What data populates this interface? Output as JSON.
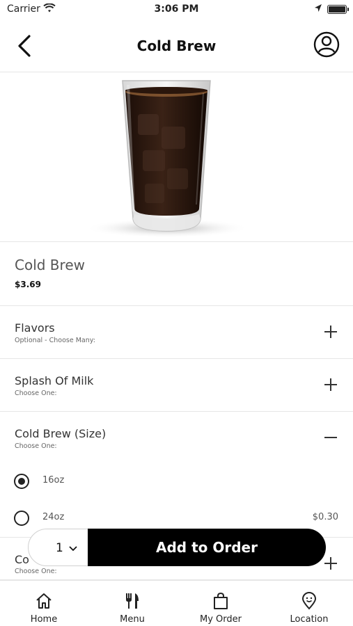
{
  "status_bar": {
    "carrier": "Carrier",
    "time": "3:06 PM"
  },
  "nav": {
    "title": "Cold Brew",
    "back_icon": "chevron-left-icon",
    "profile_icon": "user-circle-icon"
  },
  "product": {
    "name": "Cold Brew",
    "price": "$3.69"
  },
  "option_sections": [
    {
      "title": "Flavors",
      "subtitle": "Optional - Choose Many:",
      "state": "collapsed",
      "icon": "plus-icon"
    },
    {
      "title": "Splash Of Milk",
      "subtitle": "Choose One:",
      "state": "collapsed",
      "icon": "plus-icon"
    },
    {
      "title": "Cold Brew (Size)",
      "subtitle": "Choose One:",
      "state": "expanded",
      "icon": "minus-icon"
    },
    {
      "title": "Co",
      "subtitle": "Choose One:",
      "state": "collapsed",
      "icon": "plus-icon"
    }
  ],
  "size_choices": [
    {
      "label": "16oz",
      "price": "",
      "selected": true
    },
    {
      "label": "24oz",
      "price": "$0.30",
      "selected": false
    }
  ],
  "order_bar": {
    "quantity": "1",
    "add_label": "Add to Order"
  },
  "tabs": [
    {
      "label": "Home",
      "icon": "home-icon"
    },
    {
      "label": "Menu",
      "icon": "fork-knife-icon"
    },
    {
      "label": "My Order",
      "icon": "shopping-bag-icon"
    },
    {
      "label": "Location",
      "icon": "map-pin-icon"
    }
  ]
}
